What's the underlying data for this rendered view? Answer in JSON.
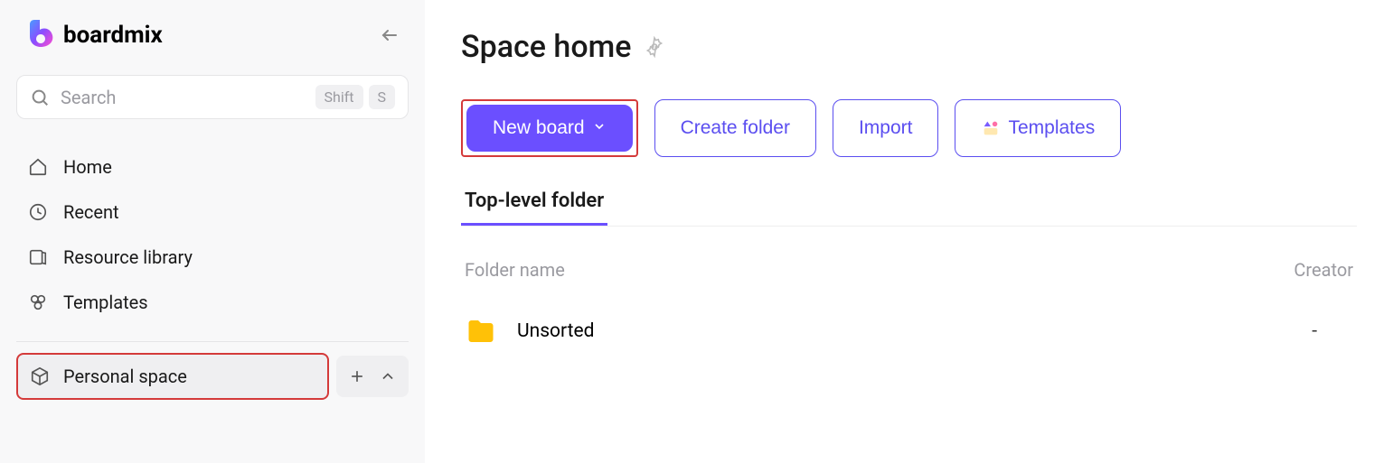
{
  "app": {
    "brand": "boardmix"
  },
  "search": {
    "placeholder": "Search",
    "shortcut_keys": [
      "Shift",
      "S"
    ]
  },
  "sidebar": {
    "nav": [
      {
        "label": "Home"
      },
      {
        "label": "Recent"
      },
      {
        "label": "Resource library"
      },
      {
        "label": "Templates"
      }
    ],
    "space": {
      "label": "Personal space"
    }
  },
  "page": {
    "title": "Space home"
  },
  "actions": {
    "new_board": "New board",
    "create_folder": "Create folder",
    "import": "Import",
    "templates": "Templates"
  },
  "tabs": {
    "active": "Top-level folder"
  },
  "table": {
    "columns": {
      "folder_name": "Folder name",
      "creator": "Creator"
    },
    "rows": [
      {
        "name": "Unsorted",
        "creator": "-"
      }
    ]
  }
}
